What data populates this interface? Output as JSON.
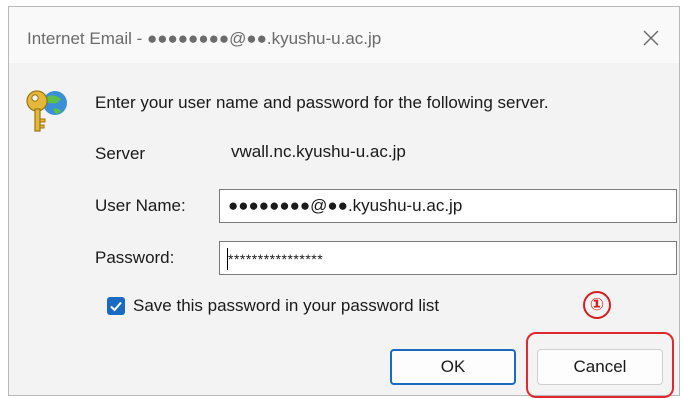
{
  "window": {
    "title": "Internet Email - ●●●●●●●●@●●.kyushu-u.ac.jp",
    "close_glyph": "✕"
  },
  "dialog": {
    "prompt": "Enter your user name and password for the following server.",
    "server_label": "Server",
    "server_value": "vwall.nc.kyushu-u.ac.jp",
    "username_label": "User Name:",
    "username_value": "●●●●●●●●@●●.kyushu-u.ac.jp",
    "password_label": "Password:",
    "password_value": "****************",
    "save_password_label": "Save this password in your password list",
    "save_password_checked": true,
    "ok_label": "OK",
    "cancel_label": "Cancel"
  },
  "annotation": {
    "step_marker": "①",
    "color": "#d21f1f"
  },
  "colors": {
    "accent": "#1b6ac2",
    "dialog_bg": "#f3f3f3"
  },
  "icons": {
    "credentials": "key-globe-icon",
    "close": "close-icon",
    "check": "checkmark-icon"
  }
}
